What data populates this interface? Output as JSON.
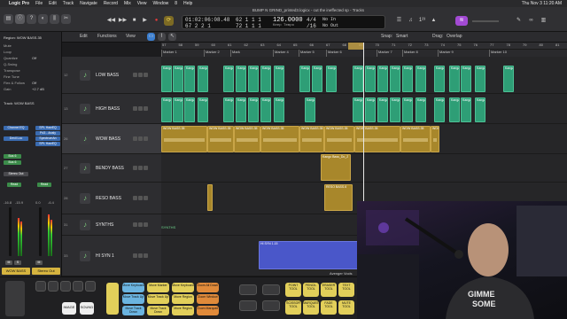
{
  "menubar": {
    "app": "Logic Pro",
    "items": [
      "File",
      "Edit",
      "Track",
      "Navigate",
      "Record",
      "Mix",
      "View",
      "Window",
      "8",
      "Help"
    ],
    "clock": "Thu Nov 3  11:20 AM"
  },
  "window_title": "BUMP N GRIND_printed3.logicx - cut the ineffected sp - Tracks",
  "lcd": {
    "time": "01:02:06:08.48",
    "bars_top": "62  1  1  1",
    "bars_bottom": "67  2  2  1",
    "bars_b2": "72  1  1  1",
    "tempo": "126.0000",
    "tempo_label": "Keep Tempo",
    "sig": "4/4",
    "div": "/16",
    "in": "No In",
    "out": "No Out"
  },
  "toolbar": {
    "edit": "Edit",
    "functions": "Functions",
    "view": "View",
    "snap_label": "Snap:",
    "snap_value": "Smart",
    "drag_label": "Drag:",
    "drag_value": "Overlap"
  },
  "inspector": {
    "region_label": "Region: WOW BASS.35",
    "rows": [
      "Mute",
      "Loop",
      "Quantize",
      "Q-Swing",
      "Transpose",
      "Fine Tune",
      "Flex & Follow",
      "Gain"
    ],
    "values": [
      "",
      "",
      "Off",
      "",
      "",
      "",
      "Off",
      "+2.7 dB"
    ],
    "track_label": "Track: WOW BASS",
    "slots_a": [
      "Channel EQ",
      "Devil Loc",
      "Bus 6",
      "Bus 6"
    ],
    "slots_b": [
      "SPL HawEQ",
      "Pd3 - Analy",
      "SpectrumAn",
      "SPL HawEQ"
    ],
    "stereo": "Stereo Out",
    "read": "Read",
    "vol_a": "-16.8",
    "vol_b": "-15.9",
    "vol_c": "0.0",
    "vol_d": "-6.4",
    "ch_a": "WOW BASS",
    "ch_b": "Stereo Out",
    "btn_m": "M",
    "btn_s": "S"
  },
  "ruler": {
    "numbers": [
      "57",
      "58",
      "59",
      "60",
      "61",
      "62",
      "63",
      "64",
      "65",
      "66",
      "67",
      "68",
      "69",
      "70",
      "71",
      "72",
      "73",
      "74",
      "75",
      "76",
      "77",
      "78",
      "79",
      "80",
      "81"
    ]
  },
  "markers": [
    "Marker 1",
    "Marker 2",
    "Mark",
    "Marker 4",
    "Marker 5",
    "Marker 6",
    "Marker 7",
    "Marker 8",
    "Marker 9",
    "Marker 10"
  ],
  "tracks": [
    {
      "num": "12",
      "name": "LOW BASS"
    },
    {
      "num": "13",
      "name": "HIGH BASS"
    },
    {
      "num": "26",
      "name": "WOW BASS"
    },
    {
      "num": "27",
      "name": "BENDY BASS"
    },
    {
      "num": "28",
      "name": "RESO BASS"
    },
    {
      "num": "31",
      "name": "SYNTHS"
    },
    {
      "num": "33",
      "name": "HI SYN 1"
    }
  ],
  "regions": {
    "midi_label": "Kangaroo",
    "wow_label": "WOW BASS.35",
    "bendy_label": "Kango Bass_Do_2",
    "reso_label": "RESO BASS.6",
    "synth_label": "SYNTHS",
    "hisyn_label": "HI SYN 1.15",
    "avenger_label": "Avenger Vocls"
  },
  "bottom_keys": {
    "left": [
      "IMAGE",
      "SOUND"
    ],
    "right": [
      "POINT TOOL",
      "PENCIL TOOL",
      "ERASER TOOL",
      "TEXT TOOL",
      "SCISSOR TOOL",
      "MARQUEE TOOL",
      "FADE TOOL",
      "MUTE TOOL"
    ],
    "mid": [
      "Move Keyboard",
      "Move Marker",
      "Move Keyboard",
      "Zoom All Down",
      "Move Track Up",
      "Move Track Up",
      "Move Region",
      "Zoom Window",
      "Move Track Down",
      "Move Track Down",
      "Move Region",
      "Zoom Marquee"
    ]
  },
  "colors": {
    "midi": "#2e9e76",
    "audio": "#a8872b",
    "synth": "#4a57c9",
    "key_yellow": "#e2cf5a",
    "key_blue": "#6bb4e0",
    "key_orange": "#e08a3a"
  }
}
